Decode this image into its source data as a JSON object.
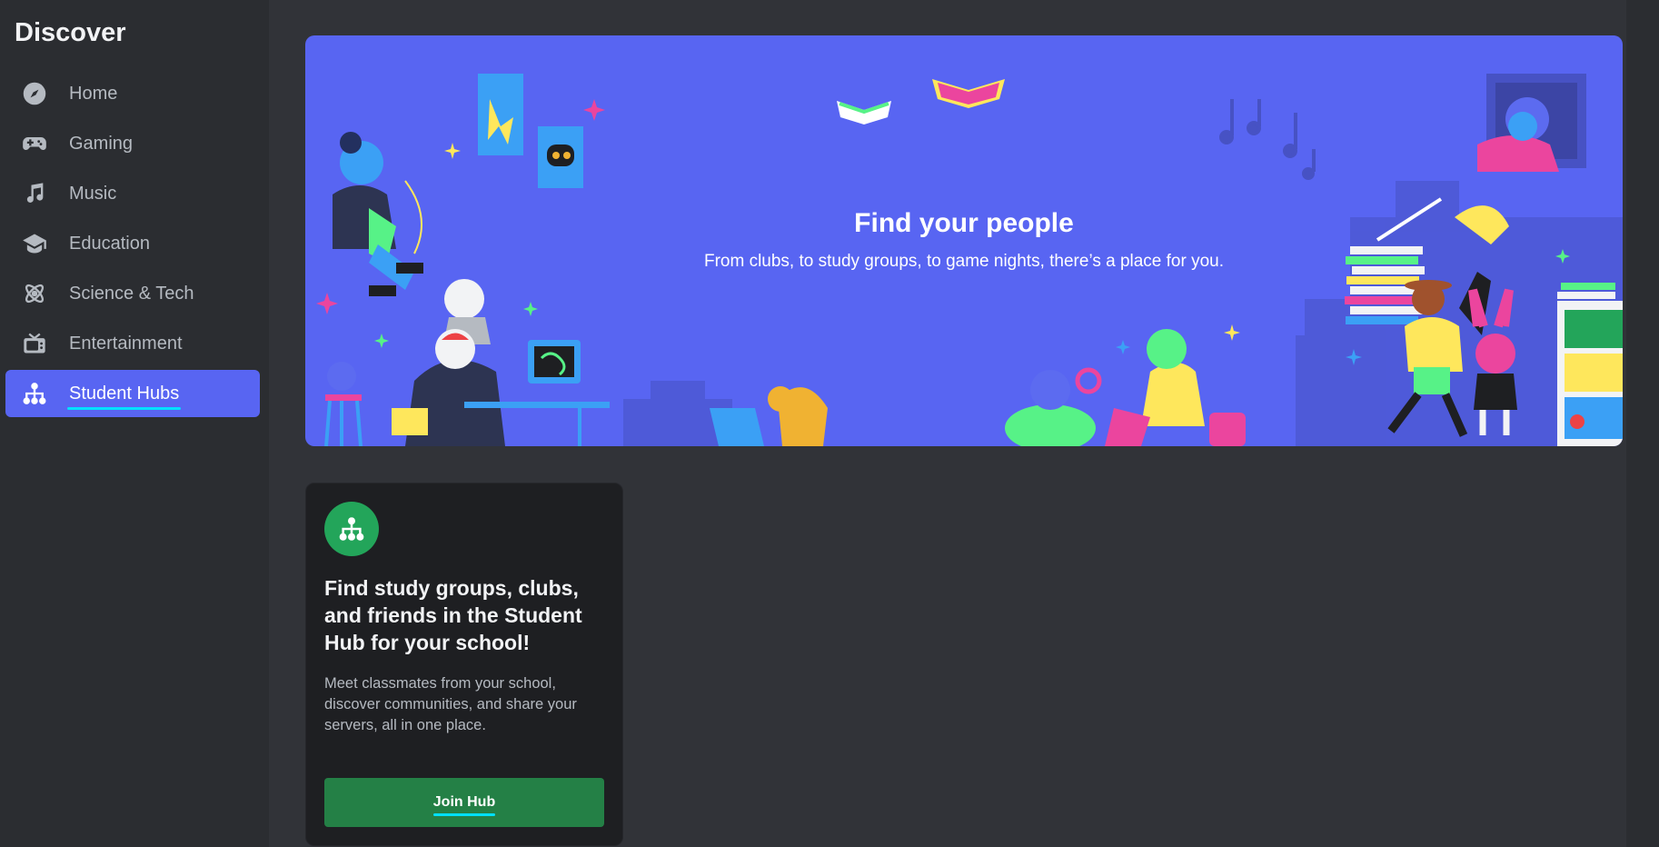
{
  "sidebar": {
    "title": "Discover",
    "items": [
      {
        "label": "Home",
        "icon": "compass-icon"
      },
      {
        "label": "Gaming",
        "icon": "gamepad-icon"
      },
      {
        "label": "Music",
        "icon": "music-note-icon"
      },
      {
        "label": "Education",
        "icon": "graduation-cap-icon"
      },
      {
        "label": "Science & Tech",
        "icon": "atom-icon"
      },
      {
        "label": "Entertainment",
        "icon": "tv-icon"
      },
      {
        "label": "Student Hubs",
        "icon": "hub-icon",
        "active": true
      }
    ]
  },
  "banner": {
    "title": "Find your people",
    "subtitle": "From clubs, to study groups, to game nights, there’s a place for you."
  },
  "hub_card": {
    "icon": "hub-icon",
    "heading": "Find study groups, clubs, and friends in the Student Hub for your school!",
    "body": "Meet classmates from your school, discover communities, and share your servers, all in one place.",
    "button_label": "Join Hub"
  },
  "colors": {
    "accent": "#5865f2",
    "join_button": "#248046",
    "hub_icon_bg": "#23a55a",
    "sidebar_bg": "#2b2d31",
    "main_bg": "#313338"
  }
}
